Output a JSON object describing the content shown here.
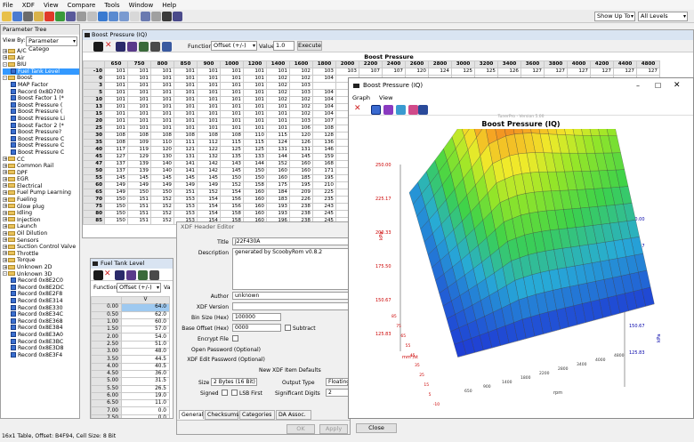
{
  "menu": [
    "File",
    "XDF",
    "View",
    "Compare",
    "Tools",
    "Window",
    "Help"
  ],
  "toolbar": {
    "show_up_to": "Show Up To",
    "levels": "All Levels"
  },
  "param_tree": {
    "title": "Parameter Tree",
    "view_by_label": "View By:",
    "view_by_value": "Parameter Catego",
    "items": [
      {
        "label": "A/C",
        "level": 0,
        "kind": "folder",
        "exp": "+"
      },
      {
        "label": "Air",
        "level": 0,
        "kind": "folder",
        "exp": "+"
      },
      {
        "label": "BIU",
        "level": 0,
        "kind": "folder",
        "exp": "-"
      },
      {
        "label": "Fuel Tank Level",
        "level": 1,
        "kind": "table",
        "sel": true
      },
      {
        "label": "Boost",
        "level": 0,
        "kind": "folder",
        "exp": "-"
      },
      {
        "label": "MAP Factor",
        "level": 1,
        "kind": "table"
      },
      {
        "label": "Record 0x8D700",
        "level": 1,
        "kind": "table"
      },
      {
        "label": "Boost Factor 1 (*",
        "level": 1,
        "kind": "table"
      },
      {
        "label": "Boost Pressure (",
        "level": 1,
        "kind": "table"
      },
      {
        "label": "Boost Pressure (",
        "level": 1,
        "kind": "table"
      },
      {
        "label": "Boost Pressure Li",
        "level": 1,
        "kind": "table"
      },
      {
        "label": "Boost Factor 2 (*",
        "level": 1,
        "kind": "table"
      },
      {
        "label": "Boost Pressure?",
        "level": 1,
        "kind": "table"
      },
      {
        "label": "Boost Pressure C",
        "level": 1,
        "kind": "table"
      },
      {
        "label": "Boost Pressure C",
        "level": 1,
        "kind": "table"
      },
      {
        "label": "Boost Pressure C",
        "level": 1,
        "kind": "table"
      },
      {
        "label": "CC",
        "level": 0,
        "kind": "folder",
        "exp": "+"
      },
      {
        "label": "Common Rail",
        "level": 0,
        "kind": "folder",
        "exp": "+"
      },
      {
        "label": "DPF",
        "level": 0,
        "kind": "folder",
        "exp": "+"
      },
      {
        "label": "EGR",
        "level": 0,
        "kind": "folder",
        "exp": "+"
      },
      {
        "label": "Electrical",
        "level": 0,
        "kind": "folder",
        "exp": "+"
      },
      {
        "label": "Fuel Pump Learning",
        "level": 0,
        "kind": "folder",
        "exp": "+"
      },
      {
        "label": "Fueling",
        "level": 0,
        "kind": "folder",
        "exp": "+"
      },
      {
        "label": "Glow plug",
        "level": 0,
        "kind": "folder",
        "exp": "+"
      },
      {
        "label": "Idling",
        "level": 0,
        "kind": "folder",
        "exp": "+"
      },
      {
        "label": "Injection",
        "level": 0,
        "kind": "folder",
        "exp": "+"
      },
      {
        "label": "Launch",
        "level": 0,
        "kind": "folder",
        "exp": "+"
      },
      {
        "label": "Oil Dilution",
        "level": 0,
        "kind": "folder",
        "exp": "+"
      },
      {
        "label": "Sensors",
        "level": 0,
        "kind": "folder",
        "exp": "+"
      },
      {
        "label": "Suction Control Valve",
        "level": 0,
        "kind": "folder",
        "exp": "+"
      },
      {
        "label": "Throttle",
        "level": 0,
        "kind": "folder",
        "exp": "+"
      },
      {
        "label": "Torque",
        "level": 0,
        "kind": "folder",
        "exp": "+"
      },
      {
        "label": "Unknown 2D",
        "level": 0,
        "kind": "folder",
        "exp": "+"
      },
      {
        "label": "Unknown 3D",
        "level": 0,
        "kind": "folder",
        "exp": "-"
      },
      {
        "label": "Record 0x8E2C0",
        "level": 1,
        "kind": "table"
      },
      {
        "label": "Record 0x8E2DC",
        "level": 1,
        "kind": "table"
      },
      {
        "label": "Record 0x8E2F8",
        "level": 1,
        "kind": "table"
      },
      {
        "label": "Record 0x8E314",
        "level": 1,
        "kind": "table"
      },
      {
        "label": "Record 0x8E330",
        "level": 1,
        "kind": "table"
      },
      {
        "label": "Record 0x8E34C",
        "level": 1,
        "kind": "table"
      },
      {
        "label": "Record 0x8E368",
        "level": 1,
        "kind": "table"
      },
      {
        "label": "Record 0x8E384",
        "level": 1,
        "kind": "table"
      },
      {
        "label": "Record 0x8E3A0",
        "level": 1,
        "kind": "table"
      },
      {
        "label": "Record 0x8E3BC",
        "level": 1,
        "kind": "table"
      },
      {
        "label": "Record 0x8E3D8",
        "level": 1,
        "kind": "table"
      },
      {
        "label": "Record 0x8E3F4",
        "level": 1,
        "kind": "table"
      }
    ]
  },
  "boost_table": {
    "title": "Boost Pressure (IQ)",
    "function_label": "Function:",
    "function_value": "Offset (+/-)",
    "value_label": "Value:",
    "value_input": "1.0",
    "execute": "Execute",
    "caption": "Boost Pressure",
    "x_caption": "rpm",
    "columns": [
      "650",
      "750",
      "800",
      "850",
      "900",
      "1000",
      "1200",
      "1400",
      "1600",
      "1800",
      "2000",
      "2200",
      "2400",
      "2600",
      "2800",
      "3000",
      "3200",
      "3400",
      "3600",
      "3800",
      "4000",
      "4200",
      "4400",
      "4800"
    ],
    "rows": [
      {
        "h": "-10",
        "v": [
          "101",
          "101",
          "101",
          "101",
          "101",
          "101",
          "101",
          "101",
          "102",
          "103",
          "103",
          "107",
          "107",
          "120",
          "124",
          "125",
          "125",
          "126",
          "127",
          "127",
          "127",
          "127",
          "127",
          "127"
        ]
      },
      {
        "h": "0",
        "v": [
          "101",
          "101",
          "101",
          "101",
          "101",
          "101",
          "101",
          "102",
          "102",
          "104",
          "",
          "",
          "",
          "",
          "",
          "",
          "",
          "",
          "",
          "",
          "",
          "",
          "",
          ""
        ]
      },
      {
        "h": "3",
        "v": [
          "101",
          "101",
          "101",
          "101",
          "101",
          "101",
          "101",
          "102",
          "103",
          "",
          "",
          "",
          "",
          "",
          "",
          "",
          "",
          "",
          "",
          "",
          "",
          "",
          "",
          ""
        ]
      },
      {
        "h": "5",
        "v": [
          "101",
          "101",
          "101",
          "101",
          "101",
          "101",
          "101",
          "102",
          "103",
          "104",
          "",
          "",
          "",
          "",
          "",
          "",
          "",
          "",
          "",
          "",
          "",
          "",
          "",
          ""
        ]
      },
      {
        "h": "10",
        "v": [
          "101",
          "101",
          "101",
          "101",
          "101",
          "101",
          "101",
          "102",
          "102",
          "104",
          "",
          "",
          "",
          "",
          "",
          "",
          "",
          "",
          "",
          "",
          "",
          "",
          "",
          ""
        ]
      },
      {
        "h": "13",
        "v": [
          "101",
          "101",
          "101",
          "101",
          "101",
          "101",
          "101",
          "101",
          "102",
          "104",
          "",
          "",
          "",
          "",
          "",
          "",
          "",
          "",
          "",
          "",
          "",
          "",
          "",
          ""
        ]
      },
      {
        "h": "15",
        "v": [
          "101",
          "101",
          "101",
          "101",
          "101",
          "101",
          "101",
          "101",
          "102",
          "104",
          "",
          "",
          "",
          "",
          "",
          "",
          "",
          "",
          "",
          "",
          "",
          "",
          "",
          ""
        ]
      },
      {
        "h": "20",
        "v": [
          "101",
          "101",
          "101",
          "101",
          "101",
          "101",
          "101",
          "101",
          "103",
          "107",
          "",
          "",
          "",
          "",
          "",
          "",
          "",
          "",
          "",
          "",
          "",
          "",
          "",
          ""
        ]
      },
      {
        "h": "25",
        "v": [
          "101",
          "101",
          "101",
          "101",
          "101",
          "101",
          "101",
          "101",
          "106",
          "108",
          "",
          "",
          "",
          "",
          "",
          "",
          "",
          "",
          "",
          "",
          "",
          "",
          "",
          ""
        ]
      },
      {
        "h": "30",
        "v": [
          "108",
          "108",
          "108",
          "108",
          "108",
          "108",
          "110",
          "115",
          "120",
          "128",
          "",
          "",
          "",
          "",
          "",
          "",
          "",
          "",
          "",
          "",
          "",
          "",
          "",
          ""
        ]
      },
      {
        "h": "35",
        "v": [
          "108",
          "109",
          "110",
          "111",
          "112",
          "115",
          "115",
          "124",
          "126",
          "136",
          "",
          "",
          "",
          "",
          "",
          "",
          "",
          "",
          "",
          "",
          "",
          "",
          "",
          ""
        ]
      },
      {
        "h": "40",
        "v": [
          "117",
          "119",
          "120",
          "121",
          "122",
          "125",
          "125",
          "131",
          "131",
          "146",
          "",
          "",
          "",
          "",
          "",
          "",
          "",
          "",
          "",
          "",
          "",
          "",
          "",
          ""
        ]
      },
      {
        "h": "45",
        "v": [
          "127",
          "129",
          "130",
          "131",
          "132",
          "135",
          "133",
          "144",
          "145",
          "159",
          "",
          "",
          "",
          "",
          "",
          "",
          "",
          "",
          "",
          "",
          "",
          "",
          "",
          ""
        ]
      },
      {
        "h": "47",
        "v": [
          "137",
          "139",
          "140",
          "141",
          "142",
          "143",
          "144",
          "152",
          "160",
          "168",
          "",
          "",
          "",
          "",
          "",
          "",
          "",
          "",
          "",
          "",
          "",
          "",
          "",
          ""
        ]
      },
      {
        "h": "50",
        "v": [
          "137",
          "139",
          "140",
          "141",
          "142",
          "145",
          "150",
          "160",
          "160",
          "171",
          "",
          "",
          "",
          "",
          "",
          "",
          "",
          "",
          "",
          "",
          "",
          "",
          "",
          ""
        ]
      },
      {
        "h": "55",
        "v": [
          "145",
          "145",
          "145",
          "145",
          "145",
          "150",
          "150",
          "160",
          "185",
          "195",
          "",
          "",
          "",
          "",
          "",
          "",
          "",
          "",
          "",
          "",
          "",
          "",
          "",
          ""
        ]
      },
      {
        "h": "60",
        "v": [
          "149",
          "149",
          "149",
          "149",
          "149",
          "152",
          "158",
          "175",
          "195",
          "210",
          "",
          "",
          "",
          "",
          "",
          "",
          "",
          "",
          "",
          "",
          "",
          "",
          "",
          ""
        ]
      },
      {
        "h": "65",
        "v": [
          "149",
          "150",
          "150",
          "151",
          "152",
          "154",
          "160",
          "184",
          "209",
          "225",
          "",
          "",
          "",
          "",
          "",
          "",
          "",
          "",
          "",
          "",
          "",
          "",
          "",
          ""
        ]
      },
      {
        "h": "70",
        "v": [
          "150",
          "151",
          "152",
          "153",
          "154",
          "156",
          "160",
          "183",
          "226",
          "235",
          "",
          "",
          "",
          "",
          "",
          "",
          "",
          "",
          "",
          "",
          "",
          "",
          "",
          ""
        ]
      },
      {
        "h": "75",
        "v": [
          "150",
          "151",
          "152",
          "153",
          "154",
          "156",
          "160",
          "193",
          "238",
          "243",
          "",
          "",
          "",
          "",
          "",
          "",
          "",
          "",
          "",
          "",
          "",
          "",
          "",
          ""
        ]
      },
      {
        "h": "80",
        "v": [
          "150",
          "151",
          "152",
          "153",
          "154",
          "158",
          "160",
          "193",
          "238",
          "245",
          "",
          "",
          "",
          "",
          "",
          "",
          "",
          "",
          "",
          "",
          "",
          "",
          "",
          ""
        ]
      },
      {
        "h": "85",
        "v": [
          "150",
          "151",
          "152",
          "153",
          "154",
          "158",
          "160",
          "196",
          "238",
          "245",
          "",
          "",
          "",
          "",
          "",
          "",
          "",
          "",
          "",
          "",
          "",
          "",
          "",
          ""
        ]
      }
    ]
  },
  "fuel_tank": {
    "title": "Fuel Tank Level",
    "function_label": "Function:",
    "function_value": "Offset (+/-)",
    "value_short": "Va",
    "col_header": "V",
    "rows": [
      [
        "0.00",
        "64.0"
      ],
      [
        "0.50",
        "62.0"
      ],
      [
        "1.00",
        "60.0"
      ],
      [
        "1.50",
        "57.0"
      ],
      [
        "2.00",
        "54.0"
      ],
      [
        "2.50",
        "51.0"
      ],
      [
        "3.00",
        "48.0"
      ],
      [
        "3.50",
        "44.5"
      ],
      [
        "4.00",
        "40.5"
      ],
      [
        "4.50",
        "36.0"
      ],
      [
        "5.00",
        "31.5"
      ],
      [
        "5.50",
        "26.5"
      ],
      [
        "6.00",
        "19.0"
      ],
      [
        "6.50",
        "11.0"
      ],
      [
        "7.00",
        "0.0"
      ],
      [
        "7.50",
        "0.0"
      ]
    ]
  },
  "xdf_header": {
    "title": "XDF Header Editor",
    "title_label": "Title",
    "title_value": "J22F430A",
    "description_label": "Description",
    "description_value": "generated by ScoobyRom v0.8.2",
    "author_label": "Author",
    "author_value": "unknown",
    "xdf_version_label": "XDF Version",
    "xdf_version_value": "",
    "bin_size_label": "Bin Size (Hex)",
    "bin_size_value": "100000",
    "base_offset_label": "Base Offset (Hex)",
    "base_offset_value": "0000",
    "subtract_label": "Subtract",
    "encrypt_file_label": "Encrypt File",
    "open_password_label": "Open Password (Optional)",
    "edit_password_label": "XDF Edit Password (Optional)",
    "defaults_heading": "New XDF Item Defaults",
    "size_label": "Size",
    "size_value": "2 Bytes (16 Bit)",
    "output_type_label": "Output Type",
    "output_type_value": "Floating Po",
    "signed_label": "Signed",
    "lsb_first_label": "LSB First",
    "sig_digits_label": "Significant Digits",
    "sig_digits_value": "2",
    "tabs": [
      "General",
      "Checksums",
      "Categories",
      "DA Assoc."
    ],
    "ok": "OK",
    "apply": "Apply",
    "close": "Close"
  },
  "graph": {
    "window_title": "Boost Pressure (IQ)",
    "menu": [
      "Graph",
      "View"
    ],
    "watermark": "TunerPro - Version 5.00",
    "chart_title": "Boost Pressure (IQ)",
    "y_ticks_left": [
      "250.00",
      "225.17",
      "200.33",
      "175.50",
      "150.67",
      "125.83"
    ],
    "y_ticks_right": [
      "250.00",
      "225.17",
      "200.33",
      "175.50",
      "150.67",
      "125.83"
    ],
    "unit_left": "kPa",
    "unit_right": "kPa",
    "axis_iq": "mm³/st",
    "axis_rpm": "rpm",
    "iq_ticks": [
      "85",
      "75",
      "65",
      "55",
      "45",
      "35",
      "25",
      "15",
      "5",
      "-10"
    ],
    "rpm_ticks": [
      "650",
      "900",
      "1400",
      "1800",
      "2200",
      "2800",
      "3400",
      "4000",
      "4800"
    ]
  },
  "status": "16x1 Table, Offset: B4F94,  Cell Size: 8 Bit",
  "brand": "Softusoft",
  "colors": {
    "surface_red": "#e0241b",
    "surface_orange": "#f5a623",
    "surface_yellow": "#f0ea2a",
    "surface_green": "#3cd24a",
    "surface_cyan": "#27d7d0",
    "surface_blue": "#1f3bd4",
    "selection": "#3399ff"
  }
}
